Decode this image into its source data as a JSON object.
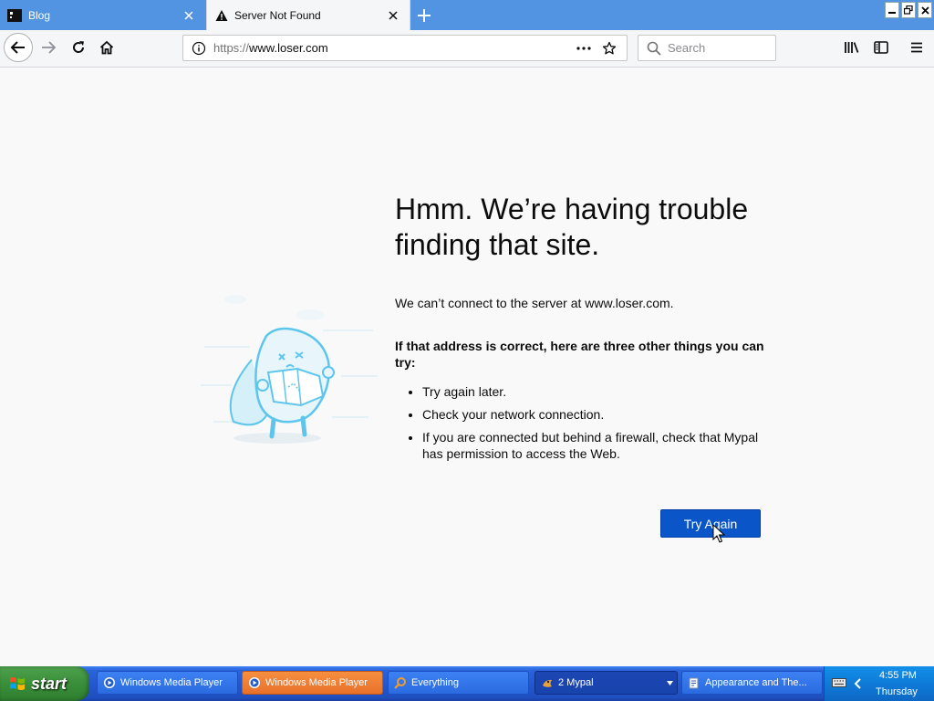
{
  "browser": {
    "tabs": [
      {
        "title": "Blog",
        "active": false
      },
      {
        "title": "Server Not Found",
        "active": true
      }
    ],
    "url": {
      "scheme": "https://",
      "host": "www.loser.com"
    },
    "search_placeholder": "Search"
  },
  "error": {
    "title_line1": "Hmm. We’re having trouble",
    "title_line2": "finding that site.",
    "short_desc": "We can’t connect to the server at www.loser.com.",
    "subheading": "If that address is correct, here are three other things you can try:",
    "suggestions": [
      "Try again later.",
      "Check your network connection.",
      "If you are connected but behind a firewall, check that Mypal has permission to access the Web."
    ],
    "try_again_label": "Try Again"
  },
  "taskbar": {
    "start_label": "start",
    "buttons": [
      {
        "label": "Windows Media Player",
        "state": "normal"
      },
      {
        "label": "Windows Media Player",
        "state": "active"
      },
      {
        "label": "Everything",
        "state": "normal"
      },
      {
        "label": "2 Mypal",
        "state": "dark"
      },
      {
        "label": "Appearance and The...",
        "state": "normal"
      }
    ],
    "clock_time": "4:55 PM",
    "clock_day": "Thursday"
  },
  "colors": {
    "accent": "#0a56c8",
    "tabstrip": "#5294e2",
    "illustration": "#5ec6ec"
  }
}
